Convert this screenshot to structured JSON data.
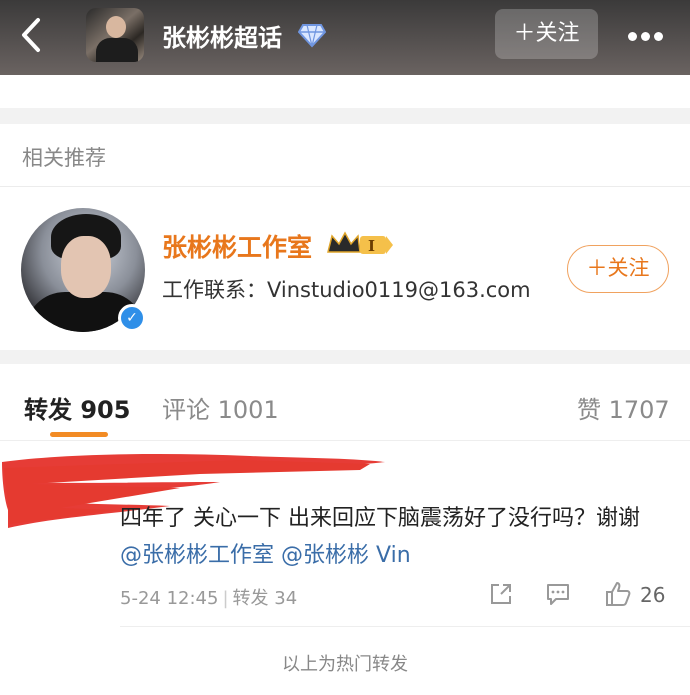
{
  "header": {
    "title": "张彬彬超话",
    "follow_label": "＋关注",
    "back_icon": "chevron-left-icon",
    "more_icon": "more-horizontal-icon",
    "badge_icon": "diamond-badge-icon"
  },
  "related": {
    "section_title": "相关推荐",
    "name": "张彬彬工作室",
    "contact": "工作联系：Vinstudio0119@163.com",
    "follow_label": "＋关注",
    "level_badge": "I",
    "verified_icon": "verified-check-icon"
  },
  "tabs": {
    "repost": "转发 905",
    "comment": "评论 1001",
    "like": "赞 1707"
  },
  "comment": {
    "text_prefix": "四年了 关心一下 出来回应下脑震荡好了没行吗？谢谢",
    "mention1": "@张彬彬工作室",
    "mention2": "@张彬彬 Vin",
    "date": "5-24 12:45",
    "repost": "转发 34",
    "like_count": "26"
  },
  "footer": {
    "note": "以上为热门转发"
  },
  "colors": {
    "accent": "#e8771c",
    "link": "#3a6da8",
    "redaction": "#e5322b"
  }
}
